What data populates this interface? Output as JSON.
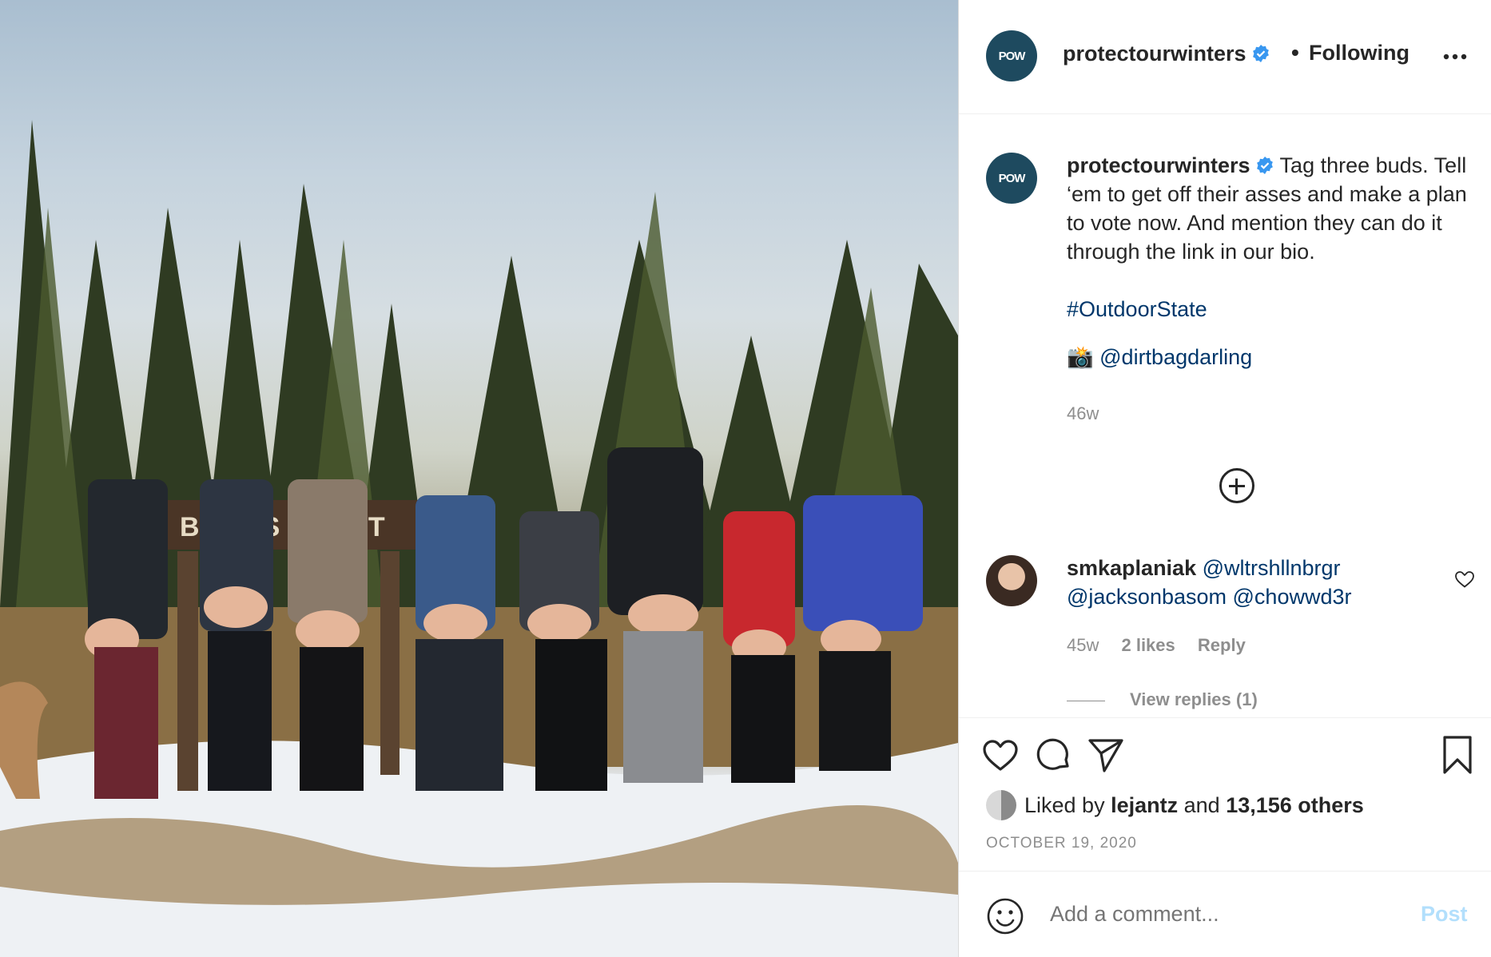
{
  "photo": {
    "sign_text": "BUTTS POINT"
  },
  "header": {
    "avatar_text": "POW",
    "username": "protectourwinters",
    "separator": "•",
    "follow_status": "Following",
    "more_icon": "more-horizontal-icon"
  },
  "caption": {
    "username": "protectourwinters",
    "text": "Tag three buds. Tell ‘em to get off their asses and make a plan to vote now. And mention they can do it through the link in our bio.",
    "hashtag": "#OutdoorState",
    "camera_emoji": "📸",
    "credit": "@dirtbagdarling",
    "timestamp": "46w"
  },
  "load_more_icon": "plus-circle-icon",
  "comment": {
    "username": "smkaplaniak",
    "mention1": "@wltrshllnbrgr",
    "mention2": "@jacksonbasom",
    "mention3": "@chowwd3r",
    "time": "45w",
    "likes": "2 likes",
    "reply": "Reply",
    "view_replies": "View replies (1)"
  },
  "actions": {
    "liked_by_prefix": "Liked by",
    "liked_by_user": "lejantz",
    "liked_and": "and",
    "liked_count": "13,156 others",
    "date": "OCTOBER 19, 2020"
  },
  "add_comment": {
    "placeholder": "Add a comment...",
    "post_label": "Post"
  },
  "colors": {
    "link": "#00376b",
    "verified": "#3897f0",
    "post_disabled": "#b2dffc",
    "avatar_bg": "#1e4a5f"
  }
}
